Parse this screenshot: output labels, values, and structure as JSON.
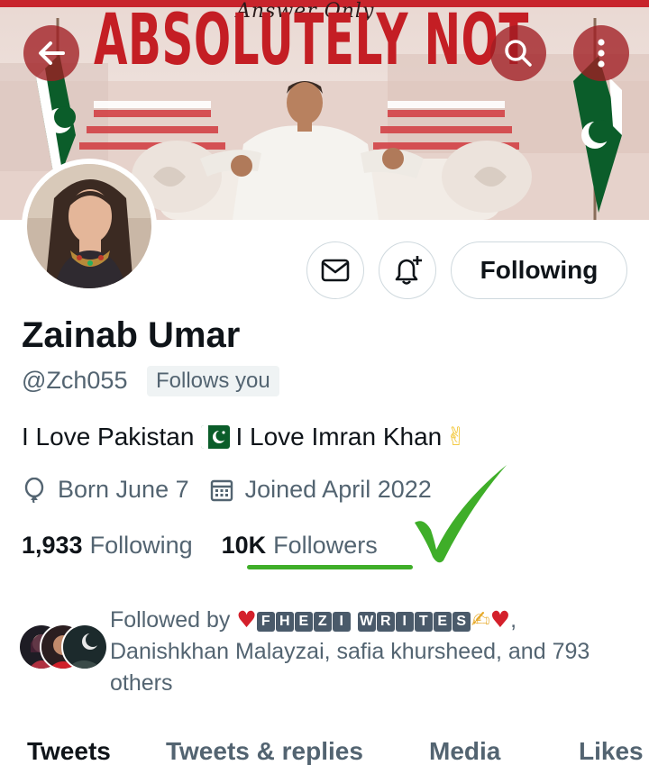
{
  "banner": {
    "tagline": "Answer Only",
    "headline": "ABSOLUTELY NOT"
  },
  "header": {
    "back_icon": "arrow-left-icon",
    "search_icon": "search-icon",
    "more_icon": "more-vertical-icon"
  },
  "profile": {
    "display_name": "Zainab Umar",
    "handle": "@Zch055",
    "follows_you_badge": "Follows you",
    "bio_part1": "I Love Pakistan",
    "bio_part2": "I Love Imran Khan",
    "bio_hand_emoji": "✌",
    "birthday": "Born June 7",
    "joined": "Joined April 2022"
  },
  "actions": {
    "message_icon": "envelope-icon",
    "notify_icon": "bell-plus-icon",
    "following_label": "Following"
  },
  "stats": {
    "following_count": "1,933",
    "following_label": "Following",
    "followers_count": "10K",
    "followers_label": "Followers"
  },
  "followed_by": {
    "prefix": "Followed by",
    "heart": "♥",
    "name_letters_1": [
      "F",
      "H",
      "E",
      "Z",
      "I"
    ],
    "name_letters_2": [
      "W",
      "R",
      "I",
      "T",
      "E",
      "S"
    ],
    "pen": "✍",
    "rest": "Danishkhan Malayzai, safia khursheed, and 793 others"
  },
  "tabs": [
    {
      "label": "Tweets"
    },
    {
      "label": "Tweets & replies"
    },
    {
      "label": "Media"
    },
    {
      "label": "Likes"
    }
  ],
  "colors": {
    "accent_red": "#c41e24",
    "annotation_green": "#3fae29",
    "muted_text": "#536471"
  }
}
